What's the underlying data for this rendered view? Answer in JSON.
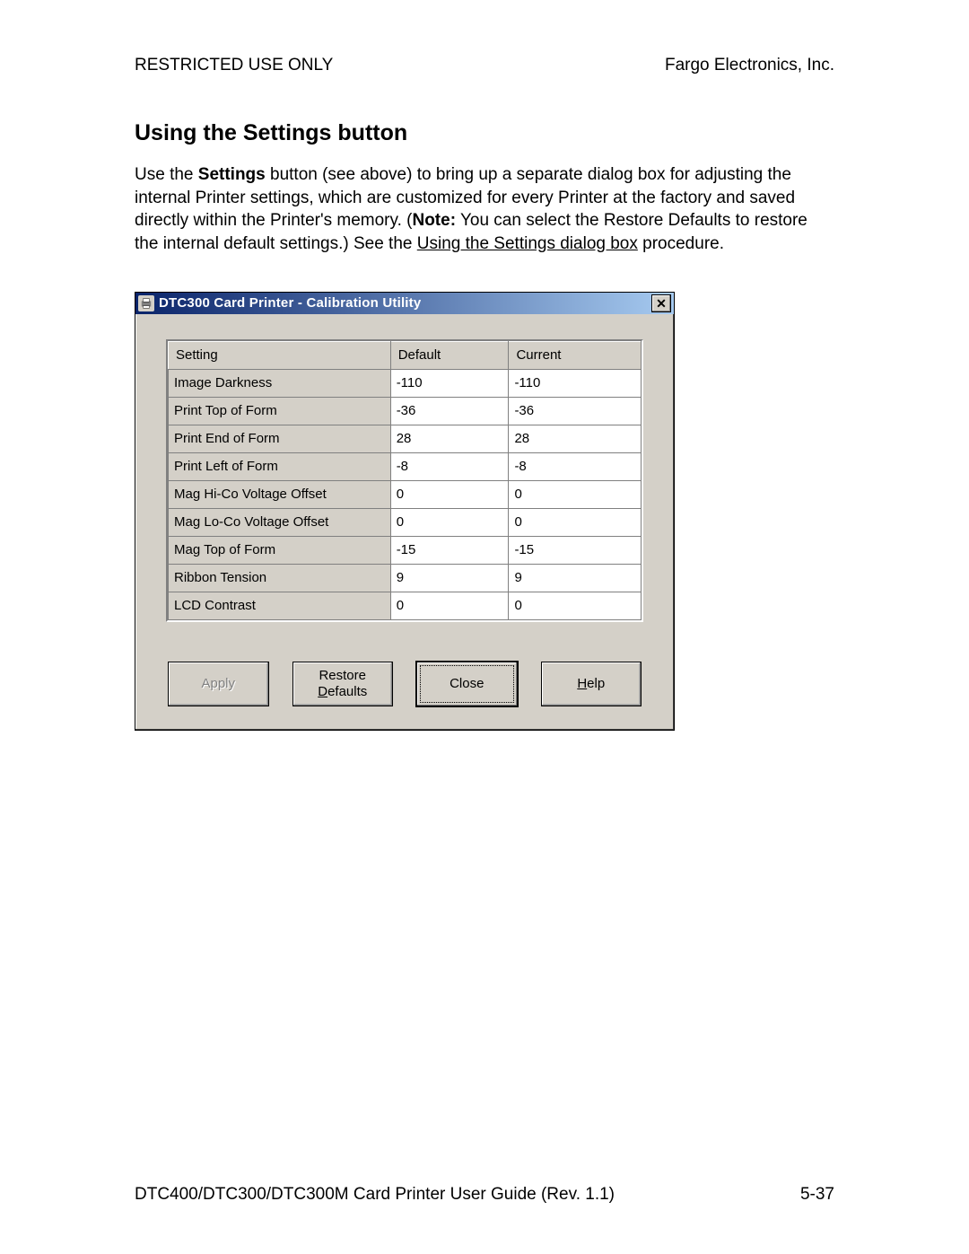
{
  "header": {
    "left": "RESTRICTED USE ONLY",
    "right": "Fargo Electronics, Inc."
  },
  "section_title": "Using the Settings button",
  "paragraph": {
    "pre": "Use the ",
    "bold1": "Settings",
    "mid1": " button (see above) to bring up a separate dialog box for adjusting the internal Printer settings, which are customized for every Printer at the factory and saved directly within the Printer's memory. (",
    "bold2": "Note:",
    "mid2": "  You can select the Restore Defaults to restore the internal default settings.) See the ",
    "link": "Using the Settings dialog box",
    "post": " procedure."
  },
  "dialog": {
    "title": "DTC300 Card Printer - Calibration Utility",
    "close_glyph": "✕",
    "columns": {
      "c0": "Setting",
      "c1": "Default",
      "c2": "Current"
    },
    "rows": [
      {
        "name": "Image Darkness",
        "def": "-110",
        "cur": "-110"
      },
      {
        "name": "Print Top of Form",
        "def": "-36",
        "cur": "-36"
      },
      {
        "name": "Print End of Form",
        "def": "28",
        "cur": "28"
      },
      {
        "name": "Print Left of Form",
        "def": "-8",
        "cur": "-8"
      },
      {
        "name": "Mag Hi-Co Voltage Offset",
        "def": "0",
        "cur": "0"
      },
      {
        "name": "Mag Lo-Co Voltage Offset",
        "def": "0",
        "cur": "0"
      },
      {
        "name": "Mag Top of Form",
        "def": "-15",
        "cur": "-15"
      },
      {
        "name": "Ribbon Tension",
        "def": "9",
        "cur": "9"
      },
      {
        "name": "LCD Contrast",
        "def": "0",
        "cur": "0"
      }
    ],
    "buttons": {
      "apply": "Apply",
      "restore_pre": "Restore",
      "restore_u": "D",
      "restore_post": "efaults",
      "close": "Close",
      "help_u": "H",
      "help_post": "elp"
    }
  },
  "footer": {
    "left": "DTC400/DTC300/DTC300M Card Printer User Guide (Rev. 1.1)",
    "right": "5-37"
  }
}
